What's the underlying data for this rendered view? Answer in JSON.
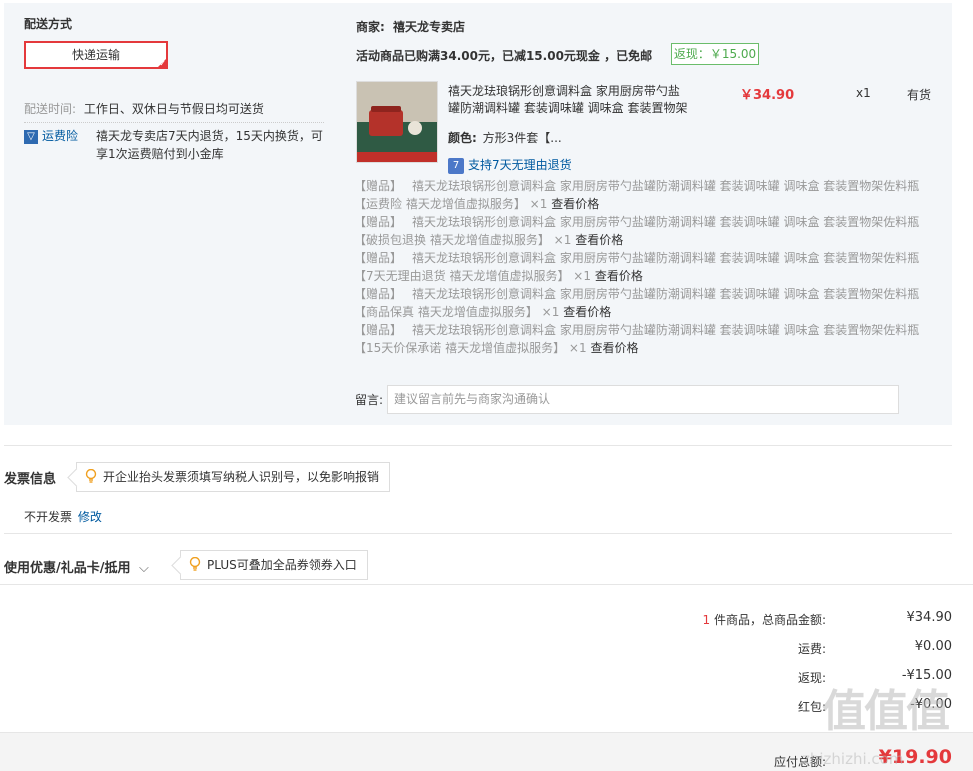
{
  "delivery": {
    "title": "配送方式",
    "method": "快递运输",
    "time_label": "配送时间:",
    "time_value": "工作日、双休日与节假日均可送货",
    "insurance_label": "运费险",
    "insurance_text_1": "禧天龙专卖店7天内退货，15天内换货，可",
    "insurance_text_2": "享1次运费赔付到小金库"
  },
  "merchant": {
    "label": "商家:",
    "name": "禧天龙专卖店",
    "promo": "活动商品已购满34.00元，已减15.00元现金 ，已免邮",
    "cashback": "返现：￥15.00"
  },
  "product": {
    "title_1": "禧天龙珐琅锅形创意调料盒 家用厨房带勺盐",
    "title_2": "罐防潮调料罐 套装调味罐 调味盒 套装置物架",
    "price": "￥34.90",
    "qty": "x1",
    "stock": "有货",
    "color_label": "颜色:",
    "color_value": "方形3件套【...",
    "return_badge": "7",
    "return_text": "支持7天无理由退货"
  },
  "gifts": [
    {
      "prefix": "【赠品】",
      "text": "禧天龙珐琅锅形创意调料盒 家用厨房带勺盐罐防潮调料罐 套装调味罐 调味盒 套装置物架佐料瓶"
    },
    {
      "prefix": "【运费险",
      "text": "禧天龙增值虚拟服务】 ×1",
      "link": "查看价格"
    },
    {
      "prefix": "【赠品】",
      "text": "禧天龙珐琅锅形创意调料盒 家用厨房带勺盐罐防潮调料罐 套装调味罐 调味盒 套装置物架佐料瓶"
    },
    {
      "prefix": "【破损包退换",
      "text": "禧天龙增值虚拟服务】 ×1",
      "link": "查看价格"
    },
    {
      "prefix": "【赠品】",
      "text": "禧天龙珐琅锅形创意调料盒 家用厨房带勺盐罐防潮调料罐 套装调味罐 调味盒 套装置物架佐料瓶"
    },
    {
      "prefix": "【7天无理由退货",
      "text": "禧天龙增值虚拟服务】 ×1",
      "link": "查看价格"
    },
    {
      "prefix": "【赠品】",
      "text": "禧天龙珐琅锅形创意调料盒 家用厨房带勺盐罐防潮调料罐 套装调味罐 调味盒 套装置物架佐料瓶"
    },
    {
      "prefix": "【商品保真",
      "text": "禧天龙增值虚拟服务】 ×1",
      "link": "查看价格"
    },
    {
      "prefix": "【赠品】",
      "text": "禧天龙珐琅锅形创意调料盒 家用厨房带勺盐罐防潮调料罐 套装调味罐 调味盒 套装置物架佐料瓶"
    },
    {
      "prefix": "【15天价保承诺",
      "text": "禧天龙增值虚拟服务】 ×1",
      "link": "查看价格"
    }
  ],
  "message": {
    "label": "留言:",
    "placeholder": "建议留言前先与商家沟通确认"
  },
  "invoice": {
    "title": "发票信息",
    "tip": "开企业抬头发票须填写纳税人识别号，以免影响报销",
    "value": "不开发票",
    "edit": "修改"
  },
  "coupon": {
    "title": "使用优惠/礼品卡/抵用",
    "tip": "PLUS可叠加全品券领券入口"
  },
  "summary": {
    "count": "1",
    "count_label": "件商品，总商品金额:",
    "total": "¥34.90",
    "shipping_label": "运费:",
    "shipping": "¥0.00",
    "cashback_label": "返现:",
    "cashback": "-¥15.00",
    "redpacket_label": "红包:",
    "redpacket": "-¥0.00",
    "payable_label": "应付总额:",
    "payable": "¥19.90"
  },
  "watermark": {
    "logo": "值值值",
    "url": "zhizhizhi.com"
  },
  "colors": {
    "accent_red": "#e4393c",
    "link_blue": "#005aa0",
    "cashback_green": "#4daa4d"
  }
}
